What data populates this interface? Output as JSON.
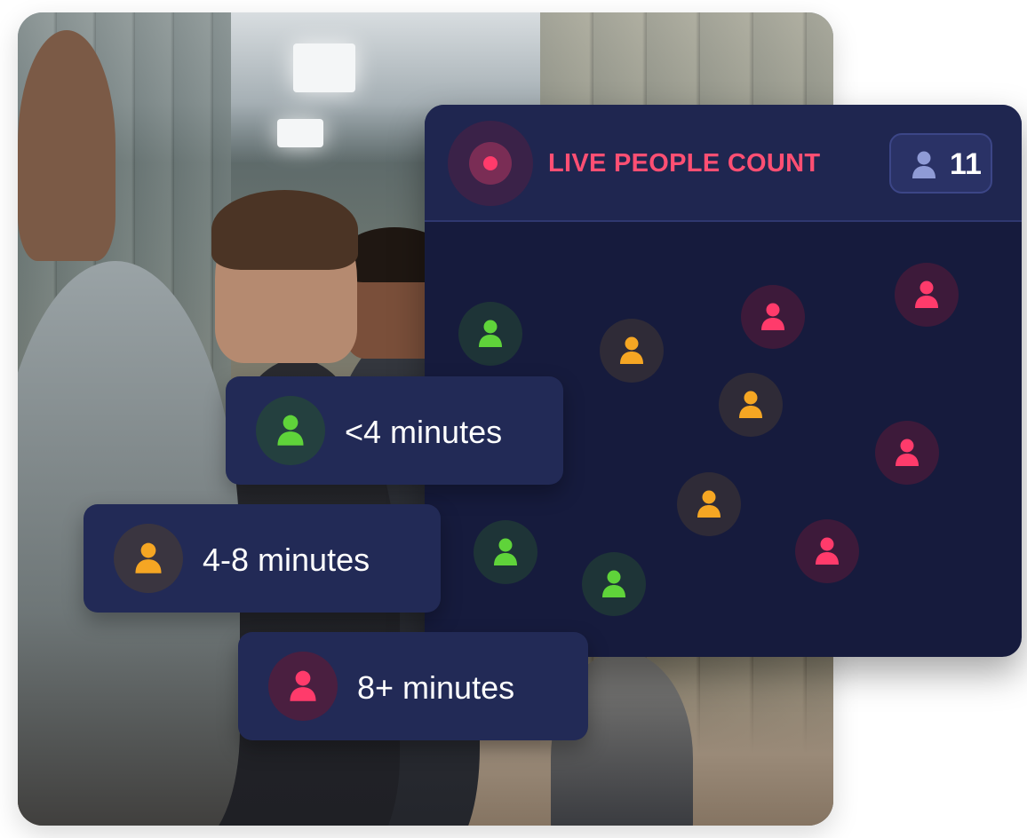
{
  "panel": {
    "title": "LIVE PEOPLE COUNT",
    "count": "11",
    "live_icon": "live-record-dot-icon",
    "count_icon": "person-icon"
  },
  "colors": {
    "green": "#5fd33a",
    "orange": "#f5a623",
    "red": "#ff3b6b",
    "title": "#ff4f73",
    "panel_bg": "#161b3d",
    "chip_bg": "#222a56"
  },
  "legend": [
    {
      "label": "<4 minutes",
      "status": "green",
      "icon": "person-icon"
    },
    {
      "label": "4-8 minutes",
      "status": "orange",
      "icon": "person-icon"
    },
    {
      "label": "8+ minutes",
      "status": "red",
      "icon": "person-icon"
    }
  ],
  "people": [
    {
      "status": "green"
    },
    {
      "status": "orange"
    },
    {
      "status": "red"
    },
    {
      "status": "red"
    },
    {
      "status": "orange"
    },
    {
      "status": "red"
    },
    {
      "status": "orange"
    },
    {
      "status": "green"
    },
    {
      "status": "green"
    },
    {
      "status": "red"
    }
  ]
}
